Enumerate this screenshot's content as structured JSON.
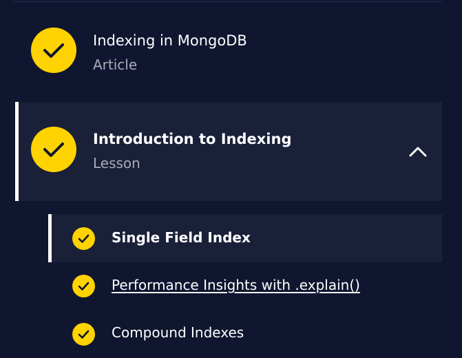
{
  "colors": {
    "background": "#10162f",
    "active_background": "#1a2038",
    "check_circle": "#ffd300",
    "check_mark": "#10162f",
    "subtitle": "#a9acb8",
    "text": "#ffffff"
  },
  "items": [
    {
      "title": "Indexing in MongoDB",
      "type": "Article",
      "icon": "check-circle-icon",
      "completed": true
    },
    {
      "title": "Introduction to Indexing",
      "type": "Lesson",
      "icon": "check-circle-icon",
      "completed": true,
      "expanded": true,
      "toggle_icon": "chevron-up-icon",
      "subitems": [
        {
          "label": "Single Field Index",
          "icon": "check-circle-icon",
          "completed": true,
          "active": true
        },
        {
          "label": "Performance Insights with .explain()",
          "icon": "check-circle-icon",
          "completed": true,
          "link": true
        },
        {
          "label": "Compound Indexes",
          "icon": "check-circle-icon",
          "completed": true
        }
      ]
    }
  ]
}
